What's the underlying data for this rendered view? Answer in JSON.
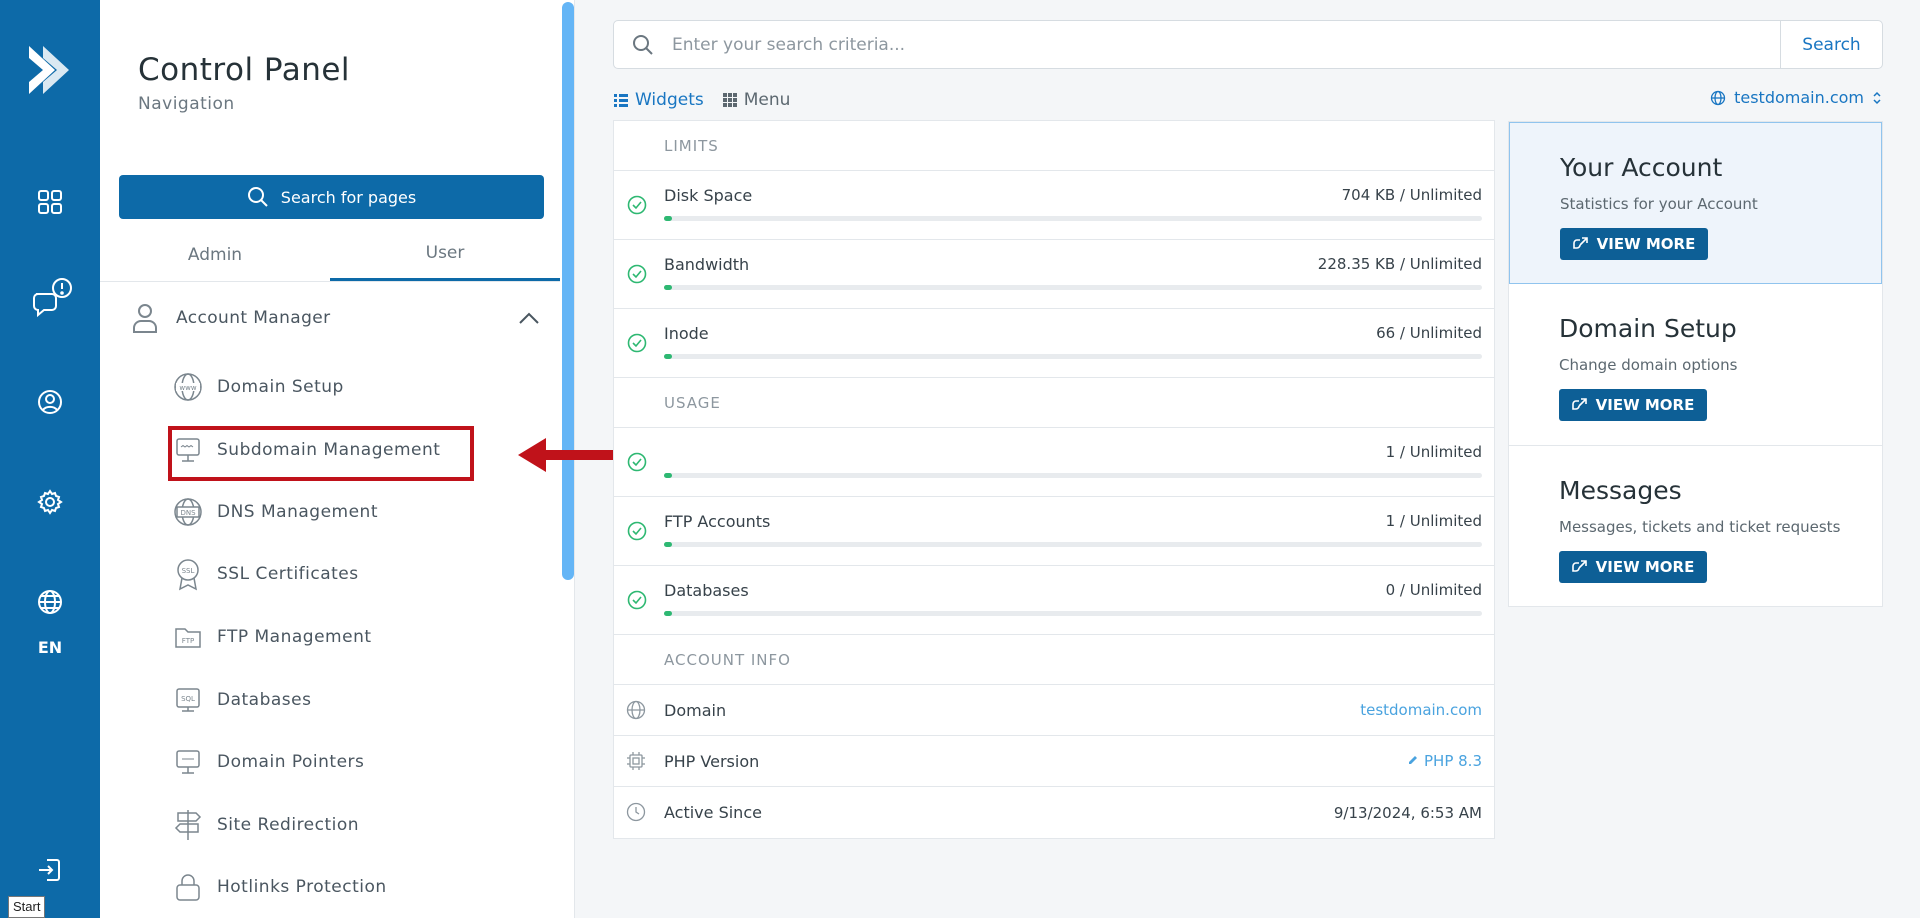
{
  "rail": {
    "icons": [
      "logo-icon",
      "dashboard-grid-icon",
      "support-tickets-icon",
      "user-account-icon",
      "settings-gear-icon",
      "language-globe-icon",
      "logout-icon"
    ],
    "language": "EN",
    "tooltip": "Start"
  },
  "nav": {
    "title": "Control Panel",
    "subtitle": "Navigation",
    "search_button": "Search for pages",
    "tabs": [
      {
        "label": "Admin",
        "active": false
      },
      {
        "label": "User",
        "active": true
      }
    ],
    "section": {
      "label": "Account Manager",
      "expanded": true
    },
    "items": [
      {
        "label": "Domain Setup",
        "icon": "www-globe-icon"
      },
      {
        "label": "Subdomain Management",
        "icon": "subdomain-monitor-icon"
      },
      {
        "label": "DNS Management",
        "icon": "dns-globe-icon"
      },
      {
        "label": "SSL Certificates",
        "icon": "ssl-badge-icon"
      },
      {
        "label": "FTP Management",
        "icon": "ftp-folder-icon"
      },
      {
        "label": "Databases",
        "icon": "sql-database-icon"
      },
      {
        "label": "Domain Pointers",
        "icon": "domain-pointer-icon"
      },
      {
        "label": "Site Redirection",
        "icon": "signpost-icon"
      },
      {
        "label": "Hotlinks Protection",
        "icon": "lock-icon"
      }
    ]
  },
  "search": {
    "placeholder": "Enter your search criteria...",
    "button": "Search"
  },
  "view_tabs": {
    "widgets": "Widgets",
    "menu": "Menu"
  },
  "domain_selector": "testdomain.com",
  "limits": {
    "header": "LIMITS",
    "rows": [
      {
        "label": "Disk Space",
        "value": "704 KB / Unlimited",
        "progress": 0.01
      },
      {
        "label": "Bandwidth",
        "value": "228.35 KB / Unlimited",
        "progress": 0.01
      },
      {
        "label": "Inode",
        "value": "66 / Unlimited",
        "progress": 0.01
      }
    ]
  },
  "usage": {
    "header": "USAGE",
    "rows": [
      {
        "label": "",
        "value": "1 / Unlimited",
        "progress": 0.01
      },
      {
        "label": "FTP Accounts",
        "value": "1 / Unlimited",
        "progress": 0.01
      },
      {
        "label": "Databases",
        "value": "0 / Unlimited",
        "progress": 0.01
      }
    ]
  },
  "account_info": {
    "header": "ACCOUNT INFO",
    "domain_label": "Domain",
    "domain_value": "testdomain.com",
    "php_label": "PHP Version",
    "php_value": "PHP 8.3",
    "active_label": "Active Since",
    "active_value": "9/13/2024, 6:53 AM"
  },
  "side_cards": [
    {
      "title": "Your Account",
      "desc": "Statistics for your Account",
      "button": "VIEW MORE",
      "active": true
    },
    {
      "title": "Domain Setup",
      "desc": "Change domain options",
      "button": "VIEW MORE",
      "active": false
    },
    {
      "title": "Messages",
      "desc": "Messages, tickets and ticket requests",
      "button": "VIEW MORE",
      "active": false
    }
  ],
  "colors": {
    "brand": "#0d6aa8",
    "highlight": "#c0121a",
    "success": "#2eb872",
    "link": "#1976c2"
  }
}
